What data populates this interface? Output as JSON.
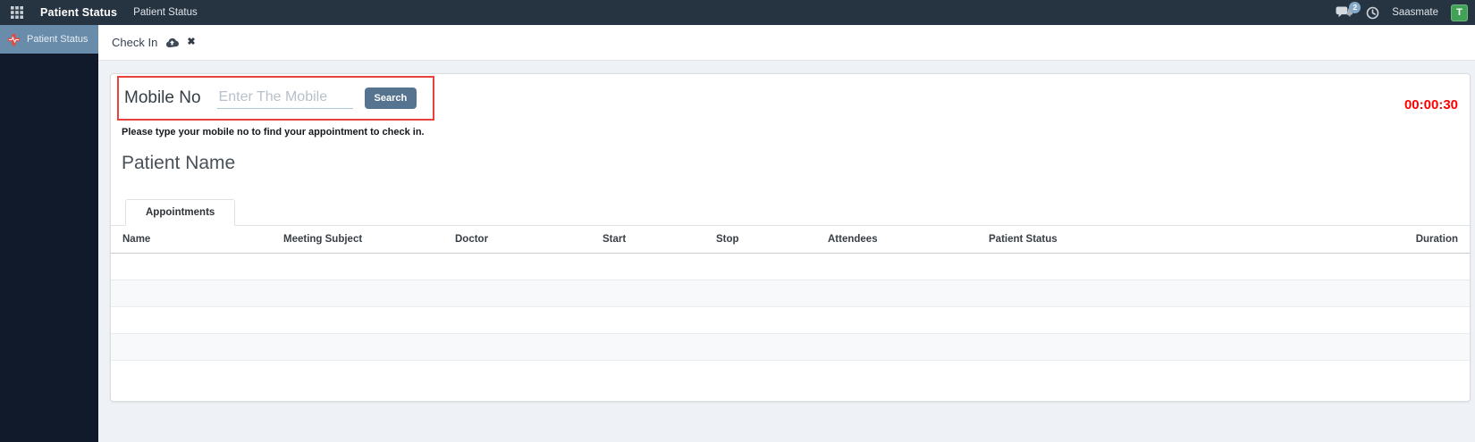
{
  "topnav": {
    "brand": "Patient Status",
    "menu_item": "Patient Status",
    "messages_badge": "2",
    "company": "Saasmate",
    "avatar_initial": "T"
  },
  "sidebar": {
    "items": [
      {
        "label": "Patient Status",
        "active": true
      }
    ]
  },
  "breadcrumb": {
    "title": "Check In"
  },
  "icons": {
    "discard_glyph": "✖"
  },
  "form": {
    "mobile_label": "Mobile No",
    "mobile_placeholder": "Enter The Mobile",
    "mobile_value": "",
    "search_button": "Search",
    "timer": "00:00:30",
    "help_text": "Please type your mobile no to find your appointment to check in.",
    "patient_name_label": "Patient Name"
  },
  "tabs": [
    {
      "label": "Appointments",
      "active": true
    }
  ],
  "table": {
    "columns": [
      "Name",
      "Meeting Subject",
      "Doctor",
      "Start",
      "Stop",
      "Attendees",
      "Patient Status",
      "Duration"
    ],
    "rows": []
  },
  "colors": {
    "topnav_bg": "#263441",
    "sidebar_bg": "#101a2b",
    "sidebar_active_bg": "#688ca9",
    "accent_red_border": "#e7423c",
    "timer_red": "#ff0000",
    "search_button_bg": "#56738f",
    "avatar_green": "#41a257",
    "badge_blue": "#84a9c9",
    "sidebar_icon_red": "#e8463e"
  }
}
